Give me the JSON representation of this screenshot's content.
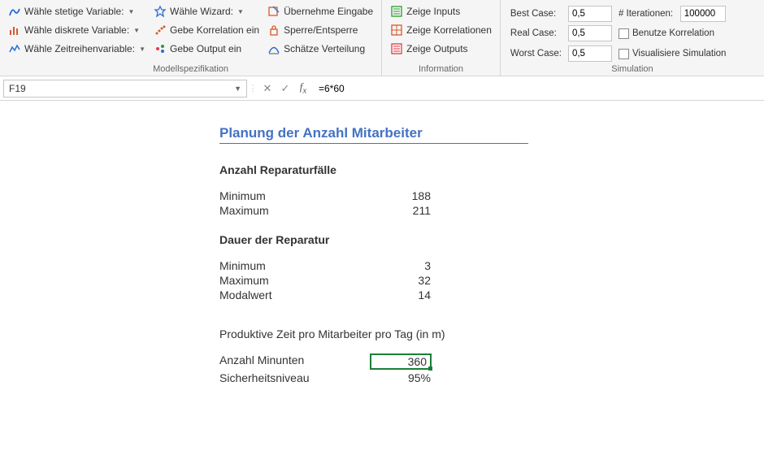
{
  "ribbon": {
    "group1": {
      "label": "Modellspezifikation",
      "colA": {
        "stetige": "Wähle stetige Variable:",
        "diskrete": "Wähle diskrete Variable:",
        "zeitreihen": "Wähle Zeitreihenvariable:"
      },
      "colB": {
        "wizard": "Wähle Wizard:",
        "korrelation": "Gebe Korrelation ein",
        "output": "Gebe Output ein"
      },
      "colC": {
        "uebernehme": "Übernehme Eingabe",
        "sperre": "Sperre/Entsperre",
        "schaetze": "Schätze Verteilung"
      }
    },
    "group2": {
      "label": "Information",
      "items": {
        "inputs": "Zeige Inputs",
        "korrelationen": "Zeige Korrelationen",
        "outputs": "Zeige Outputs"
      }
    },
    "group3": {
      "label": "Simulation",
      "labels": {
        "best": "Best Case:",
        "real": "Real Case:",
        "worst": "Worst Case:",
        "iter": "# Iterationen:",
        "korrel": "Benutze Korrelation",
        "visual": "Visualisiere Simulation"
      },
      "values": {
        "best": "0,5",
        "real": "0,5",
        "worst": "0,5",
        "iter": "100000"
      }
    }
  },
  "formula_bar": {
    "cell_ref": "F19",
    "formula": "=6*60"
  },
  "sheet": {
    "title": "Planung der Anzahl Mitarbeiter",
    "sec1": {
      "head": "Anzahl Reparaturfälle",
      "min_label": "Minimum",
      "min_val": "188",
      "max_label": "Maximum",
      "max_val": "211"
    },
    "sec2": {
      "head": "Dauer der Reparatur",
      "min_label": "Minimum",
      "min_val": "3",
      "max_label": "Maximum",
      "max_val": "32",
      "mode_label": "Modalwert",
      "mode_val": "14"
    },
    "sec3": {
      "head": "Produktive Zeit pro Mitarbeiter pro Tag (in m)",
      "minutes_label": "Anzahl Minunten",
      "minutes_val": "360",
      "safety_label": "Sicherheitsniveau",
      "safety_val": "95%"
    }
  }
}
